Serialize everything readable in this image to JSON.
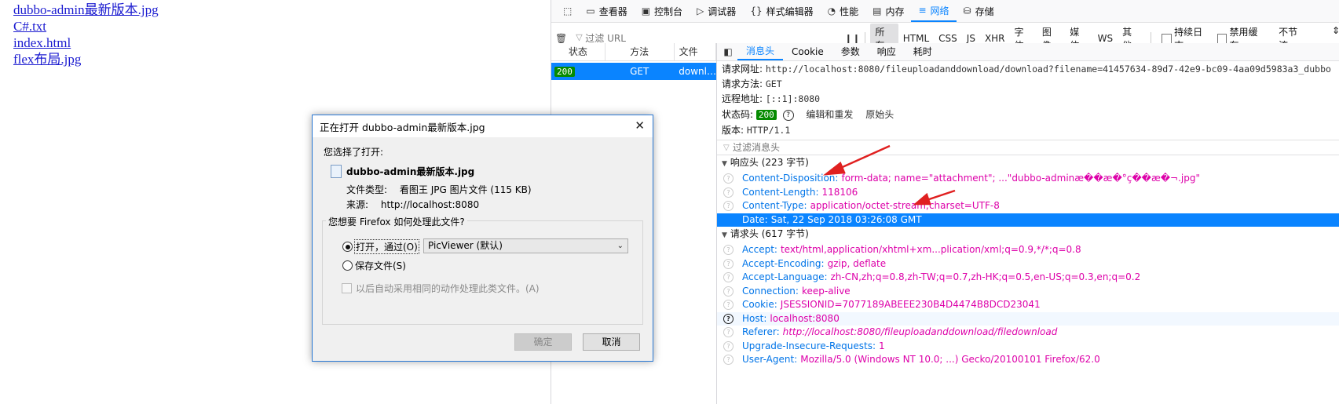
{
  "page": {
    "links": [
      "dubbo-admin最新版本.jpg",
      "C#.txt",
      "index.html",
      "flex布局.jpg"
    ]
  },
  "devtools": {
    "tools": [
      {
        "icon": "pick-element-icon",
        "label": ""
      },
      {
        "icon": "inspector-icon",
        "label": "查看器"
      },
      {
        "icon": "console-icon",
        "label": "控制台"
      },
      {
        "icon": "debugger-icon",
        "label": "调试器"
      },
      {
        "icon": "style-editor-icon",
        "label": "样式编辑器"
      },
      {
        "icon": "performance-icon",
        "label": "性能"
      },
      {
        "icon": "memory-icon",
        "label": "内存"
      },
      {
        "icon": "network-icon",
        "label": "网络"
      },
      {
        "icon": "storage-icon",
        "label": "存储"
      }
    ],
    "active_tool": "网络",
    "filter_placeholder": "过滤 URL",
    "filter_types": [
      "所有",
      "HTML",
      "CSS",
      "JS",
      "XHR",
      "字体",
      "图像",
      "媒体",
      "WS",
      "其他"
    ],
    "persist_log": "持续日志",
    "disable_cache": "禁用缓存",
    "throttle": "不节流",
    "columns": [
      "状态",
      "方法",
      "文件"
    ],
    "request": {
      "status": "200",
      "method": "GET",
      "file": "downl…"
    },
    "detail_tabs": [
      "消息头",
      "Cookie",
      "参数",
      "响应",
      "耗时"
    ],
    "summary": {
      "url_label": "请求网址:",
      "url": "http://localhost:8080/fileuploadanddownload/download?filename=41457634-89d7-42e9-bc09-4aa09d5983a3_dubbo",
      "method_label": "请求方法:",
      "method": "GET",
      "remote_label": "远程地址:",
      "remote": "[::1]:8080",
      "status_label": "状态码:",
      "status": "200",
      "edit_resend": "编辑和重发",
      "raw_headers": "原始头",
      "version_label": "版本:",
      "version": "HTTP/1.1"
    },
    "headers_filter_placeholder": "过滤消息头",
    "response_headers_title": "响应头 (223 字节)",
    "response_headers": [
      {
        "k": "Content-Disposition:",
        "v": "form-data; name=\"attachment\"; ...\"dubbo-adminæ��æ�°ç��æ�¬.jpg\""
      },
      {
        "k": "Content-Length:",
        "v": "118106"
      },
      {
        "k": "Content-Type:",
        "v": "application/octet-stream;charset=UTF-8"
      },
      {
        "k": "Date:",
        "v": "Sat, 22 Sep 2018 03:26:08 GMT"
      }
    ],
    "request_headers_title": "请求头 (617 字节)",
    "request_headers": [
      {
        "k": "Accept:",
        "v": "text/html,application/xhtml+xm...plication/xml;q=0.9,*/*;q=0.8"
      },
      {
        "k": "Accept-Encoding:",
        "v": "gzip, deflate"
      },
      {
        "k": "Accept-Language:",
        "v": "zh-CN,zh;q=0.8,zh-TW;q=0.7,zh-HK;q=0.5,en-US;q=0.3,en;q=0.2"
      },
      {
        "k": "Connection:",
        "v": "keep-alive"
      },
      {
        "k": "Cookie:",
        "v": "JSESSIONID=7077189ABEEE230B4D4474B8DCD23041"
      },
      {
        "k": "Host:",
        "v": "localhost:8080"
      },
      {
        "k": "Referer:",
        "v": "http://localhost:8080/fileuploadanddownload/filedownload"
      },
      {
        "k": "Upgrade-Insecure-Requests:",
        "v": "1"
      },
      {
        "k": "User-Agent:",
        "v": "Mozilla/5.0 (Windows NT 10.0; ...) Gecko/20100101 Firefox/62.0"
      }
    ]
  },
  "dialog": {
    "title": "正在打开 dubbo-admin最新版本.jpg",
    "chosen": "您选择了打开:",
    "file_name": "dubbo-admin最新版本.jpg",
    "type_label": "文件类型:",
    "type_value": "看图王 JPG 图片文件 (115 KB)",
    "source_label": "来源:",
    "source_value": "http://localhost:8080",
    "question": "您想要 Firefox 如何处理此文件?",
    "open_with": "打开，通过(O)",
    "app": "PicViewer (默认)",
    "save_file": "保存文件(S)",
    "auto_action": "以后自动采用相同的动作处理此类文件。(A)",
    "ok": "确定",
    "cancel": "取消"
  },
  "colors": {
    "accent": "#0a84ff",
    "status_ok": "#058b00",
    "header_key": "#0074e8",
    "header_value": "#dd00a9",
    "arrow": "#e02020"
  }
}
